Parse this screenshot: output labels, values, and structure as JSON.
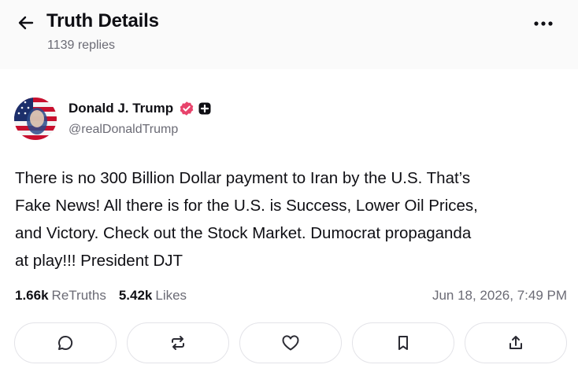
{
  "header": {
    "title": "Truth Details",
    "replies": "1139 replies"
  },
  "author": {
    "display_name": "Donald J. Trump",
    "handle": "@realDonaldTrump",
    "verified_color": "#e8436b"
  },
  "post": {
    "lines": [
      "There is no 300 Billion Dollar payment to Iran by the U.S. That’s",
      "Fake News! All there is for the U.S. is Success, Lower Oil Prices,",
      "and Victory. Check out the Stock Market. Dumocrat propaganda",
      "at play!!! President DJT"
    ]
  },
  "stats": {
    "retruths_count": "1.66k",
    "retruths_label": "ReTruths",
    "likes_count": "5.42k",
    "likes_label": "Likes",
    "timestamp": "Jun 18, 2026, 7:49 PM"
  },
  "actions": [
    {
      "name": "reply",
      "icon": "comment-icon"
    },
    {
      "name": "retruth",
      "icon": "repost-icon"
    },
    {
      "name": "like",
      "icon": "heart-icon"
    },
    {
      "name": "bookmark",
      "icon": "bookmark-icon"
    },
    {
      "name": "share",
      "icon": "share-icon"
    }
  ]
}
